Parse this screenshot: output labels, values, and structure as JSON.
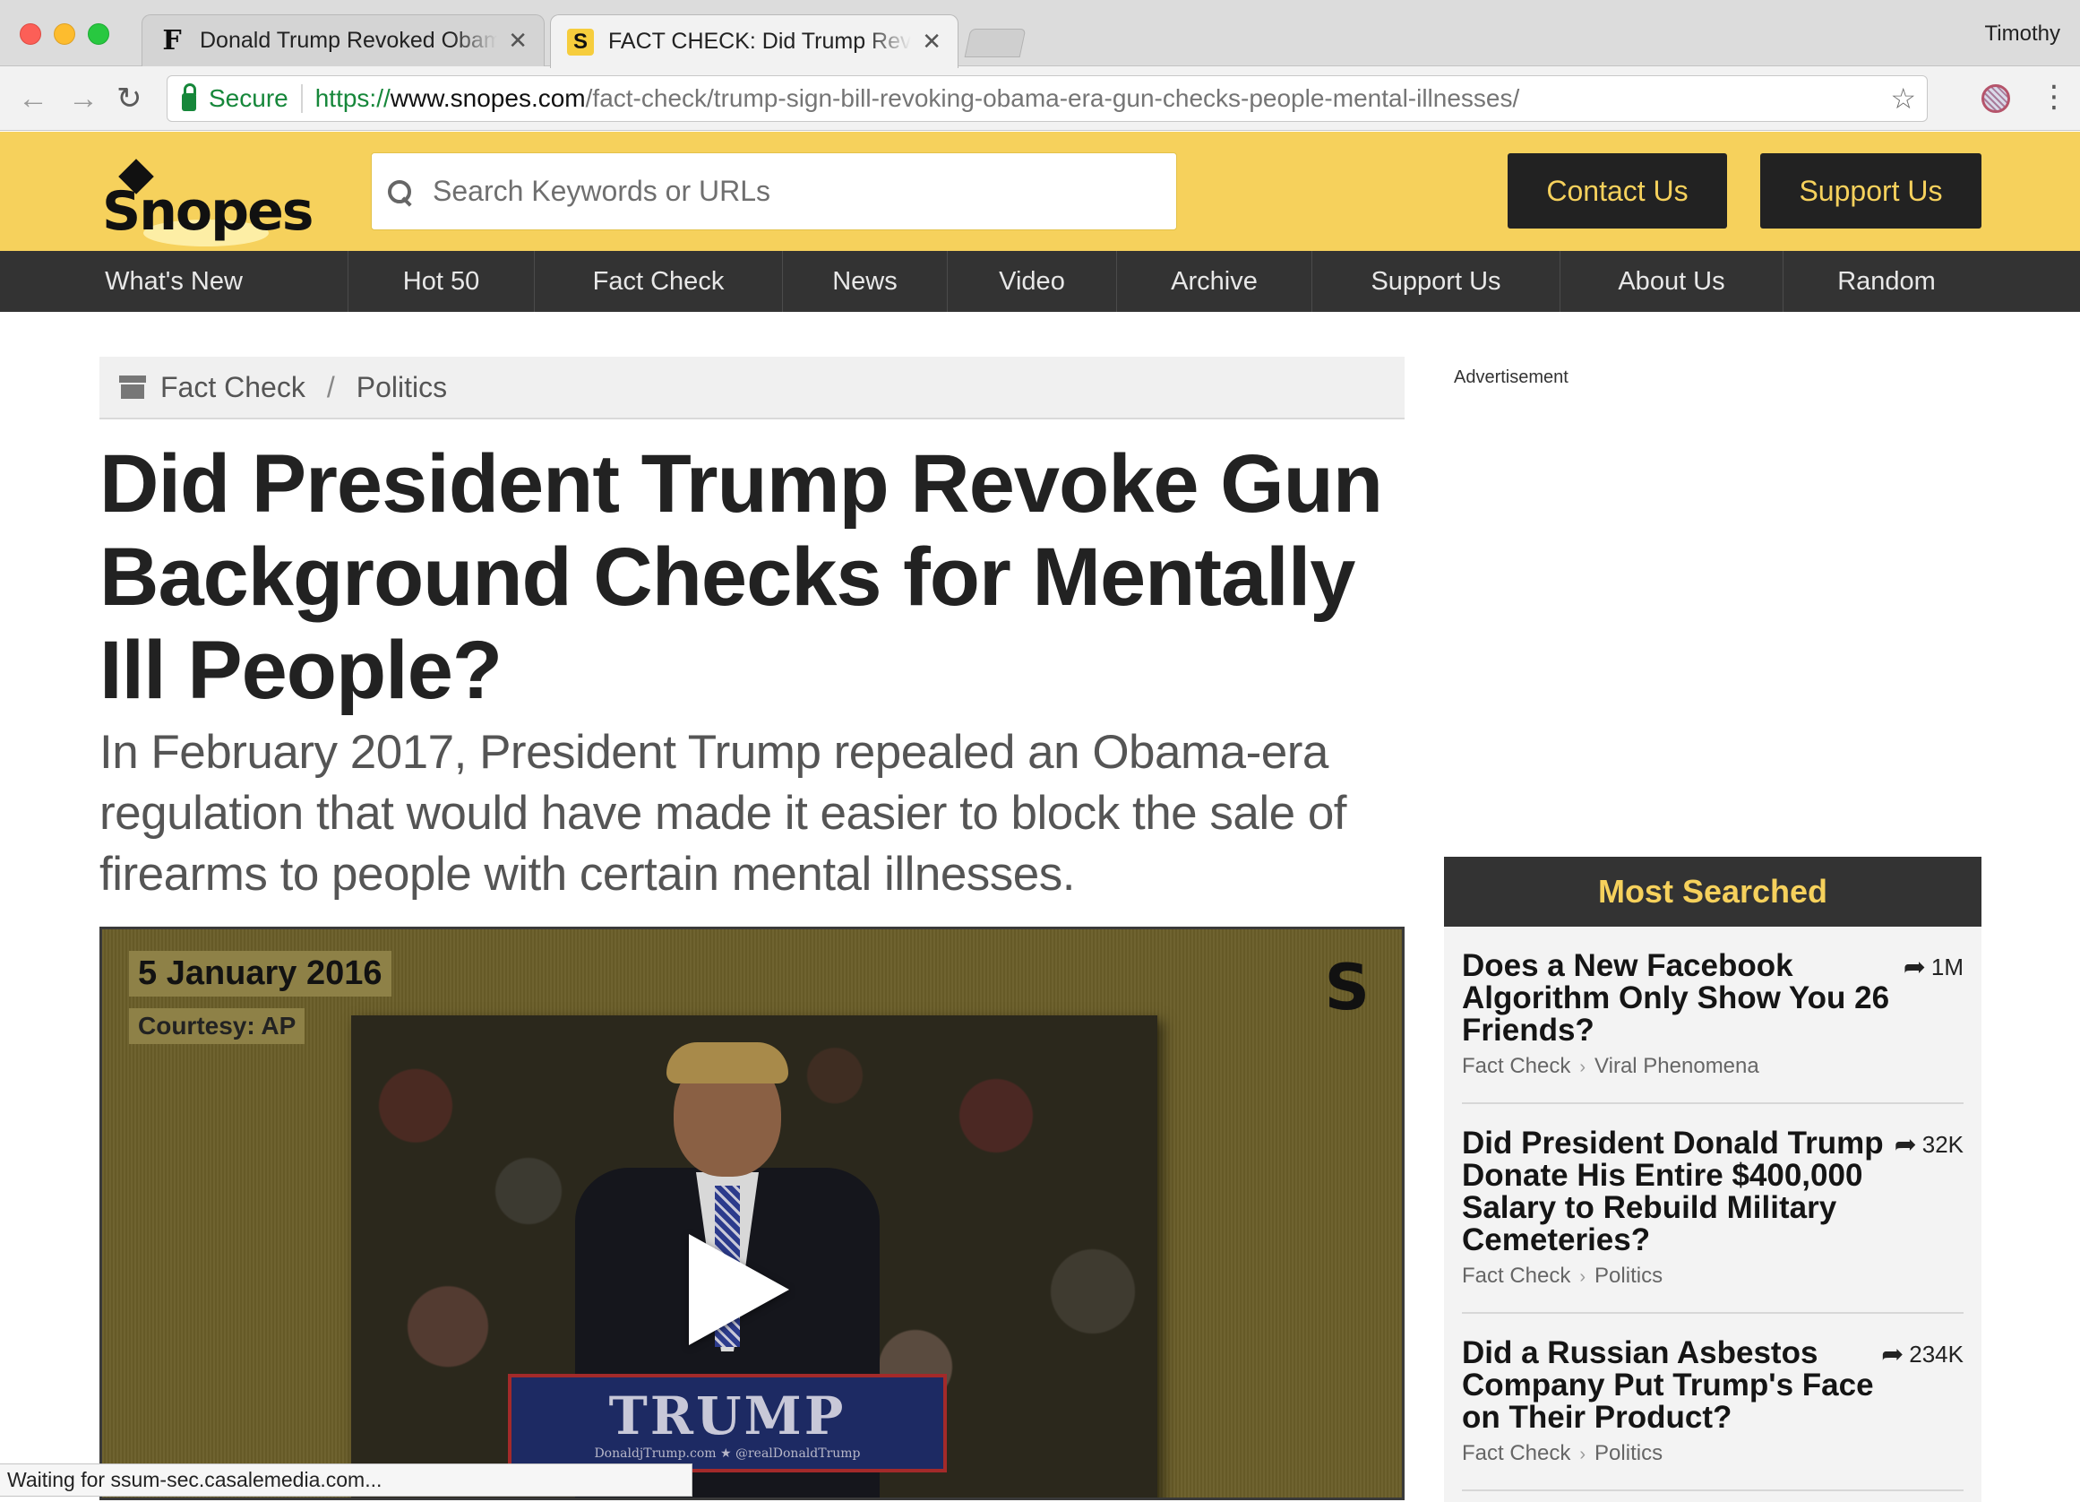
{
  "browser": {
    "tabs": [
      {
        "title": "Donald Trump Revoked Obama",
        "favicon": "F"
      },
      {
        "title": "FACT CHECK: Did Trump Revol",
        "favicon": "S"
      }
    ],
    "profile_name": "Timothy",
    "url": {
      "secure_label": "Secure",
      "scheme": "https://",
      "host": "www.snopes.com",
      "path": "/fact-check/trump-sign-bill-revoking-obama-era-gun-checks-people-mental-illnesses/"
    },
    "status": "Waiting for ssum-sec.casalemedia.com..."
  },
  "site": {
    "logo_text": "Snopes",
    "search_placeholder": "Search Keywords or URLs",
    "header_buttons": {
      "contact": "Contact Us",
      "support": "Support Us"
    },
    "nav": [
      "What's New",
      "Hot 50",
      "Fact Check",
      "News",
      "Video",
      "Archive",
      "Support Us",
      "About Us",
      "Random"
    ],
    "colors": {
      "brand_yellow": "#f6d15c",
      "nav_dark": "#333333"
    }
  },
  "article": {
    "breadcrumb": [
      "Fact Check",
      "Politics"
    ],
    "headline": "Did President Trump Revoke Gun Background Checks for Mentally Ill People?",
    "subhead": "In February 2017, President Trump repealed an Obama-era regulation that would have made it easier to block the sale of firearms to people with certain mental illnesses.",
    "video": {
      "date": "5 January 2016",
      "credit": "Courtesy: AP",
      "logo_mark": "S",
      "sign_text": "TRUMP",
      "sign_small": "DonaldjTrump.com ★ @realDonaldTrump"
    }
  },
  "sidebar": {
    "ad_label": "Advertisement",
    "most_searched_title": "Most Searched",
    "items": [
      {
        "title": "Does a New Facebook Algorithm Only Show You 26 Friends?",
        "shares": "1M",
        "category": "Fact Check",
        "subcategory": "Viral Phenomena"
      },
      {
        "title": "Did President Donald Trump Donate His Entire $400,000 Salary to Rebuild Military Cemeteries?",
        "shares": "32K",
        "category": "Fact Check",
        "subcategory": "Politics"
      },
      {
        "title": "Did a Russian Asbestos Company Put Trump's Face on Their Product?",
        "shares": "234K",
        "category": "Fact Check",
        "subcategory": "Politics"
      }
    ]
  }
}
